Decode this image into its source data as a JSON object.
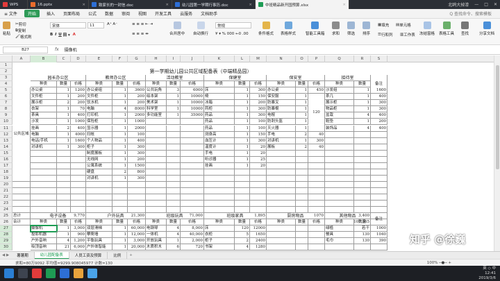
{
  "tabs": [
    {
      "label": "WPS",
      "color": "#e33b3b"
    },
    {
      "label": "16.pptx",
      "color": "#e86c2c"
    },
    {
      "label": "致家长的一封信.doc",
      "color": "#2d6fd6"
    },
    {
      "label": "幼儿园第一学期行事历.doc",
      "color": "#2d6fd6"
    },
    {
      "label": "中班精品新开园预算.xlsx",
      "color": "#1e9c54"
    }
  ],
  "window_controls": {
    "user": "北鸥大掉漆",
    "min": "—",
    "max": "□",
    "close": "✕"
  },
  "menu": {
    "file": "≡ 文件",
    "start": "开始",
    "items": [
      "插入",
      "页面布局",
      "公式",
      "数据",
      "审阅",
      "视图",
      "开发工具",
      "云服务",
      "文档助手"
    ],
    "search": "Q 查找命令、搜索模板"
  },
  "ribbon": {
    "paste": "粘贴",
    "cut": "剪切",
    "copy": "复制",
    "format_painter": "格式刷",
    "font_name": "宋体",
    "font_size": "11",
    "merge": "合并居中",
    "wrap": "自动换行",
    "number_format": "常规",
    "cond_format": "条件格式",
    "table_style": "表格样式",
    "smart_toolbox": "智能工具箱",
    "sum": "求和",
    "filter": "筛选",
    "sort": "排序",
    "fill": "填充",
    "cell": "单元格",
    "row_col": "行和列",
    "worksheet": "工作表",
    "freeze": "冻结窗格",
    "table_tools": "表格工具",
    "find": "查找",
    "symbol": "符号",
    "share": "分享文档"
  },
  "formula_bar": {
    "cell_ref": "B27",
    "fx": "fx",
    "content": "摄像机"
  },
  "columns": [
    "A",
    "B",
    "C",
    "D",
    "E",
    "F",
    "G",
    "H",
    "I",
    "J",
    "K",
    "L",
    "M",
    "N",
    "O",
    "P",
    "Q",
    "R",
    "S"
  ],
  "rows": [
    "1",
    "2",
    "3",
    "4",
    "5",
    "6",
    "7",
    "8",
    "9",
    "10",
    "11",
    "12",
    "13",
    "14",
    "15",
    "16",
    "17",
    "18",
    "19",
    "20",
    "21",
    "22",
    "23",
    "24",
    "25",
    "26",
    "27",
    "28",
    "29",
    "30"
  ],
  "sheet": {
    "title": "第一学期幼儿园公共区域配备表（中端精品园）",
    "sections_top": [
      "园长办公区",
      "教师办公区",
      "活动教室",
      "保健室",
      "保安室",
      "接待室"
    ],
    "notes": "备注",
    "hdr": [
      "种类",
      "数量",
      "价格"
    ],
    "area_label": "公共区域",
    "r5": [
      "办公桌",
      "1",
      "1200",
      "办公桌组",
      "1",
      "3600",
      "公共玩角",
      "3",
      "6000",
      "床",
      "1",
      "300",
      "办公桌",
      "1",
      "450",
      "沙发组",
      "1",
      "1600"
    ],
    "r6": [
      "文件柜",
      "1",
      "200",
      "文件柜",
      "1",
      "200",
      "绘本架",
      "1",
      "10000",
      "椅",
      "1",
      "150",
      "保安服",
      "1",
      "120",
      "茶几",
      "1",
      "400"
    ],
    "r7": [
      "展示柜",
      "2",
      "200",
      "饮水机",
      "1",
      "200",
      "美术架",
      "1",
      "10000",
      "冰箱",
      "1",
      "200",
      "防暴叉",
      "1",
      "",
      "展示柜",
      "1",
      "300"
    ],
    "r8": [
      "衣架",
      "1",
      "70",
      "电脑",
      "4",
      "8000",
      "科学室",
      "1",
      "10000",
      "药柜",
      "1",
      "300",
      "防暴棍",
      "1",
      "",
      "物品柜",
      "1",
      "300"
    ],
    "r9": [
      "茶具",
      "1",
      "400",
      "打印机",
      "1",
      "2000",
      "多功能室",
      "1",
      "35000",
      "药品",
      "1",
      "300",
      "电棍",
      "1",
      "",
      "盆栽",
      "4",
      "400"
    ],
    "r10": [
      "沙发",
      "1",
      "1000",
      "保险柜",
      "1",
      "1000",
      "",
      "",
      "",
      "药品",
      "1",
      "100",
      "防刺头盔",
      "1",
      "",
      "鞋垫",
      "1",
      "200"
    ],
    "r11": [
      "挂画",
      "2",
      "400",
      "显示器",
      "1",
      "2000",
      "",
      "",
      "",
      "药品",
      "1",
      "100",
      "灭火器",
      "1",
      "",
      "装饰品",
      "4",
      "400"
    ],
    "r12": [
      "电脑",
      "1",
      "4000",
      "扫帐",
      "1",
      "100",
      "",
      "",
      "",
      "测身高",
      "1",
      "150",
      "手电",
      "2",
      "40",
      "",
      "",
      ""
    ],
    "r13": [
      "电话/手机",
      "1",
      "1600",
      "个人物品",
      "1",
      "400",
      "",
      "",
      "",
      "血压计",
      "1",
      "300",
      "对讲机",
      "1",
      "300",
      "",
      "",
      ""
    ],
    "r14": [
      "对讲机",
      "1",
      "300",
      "柜子",
      "1",
      "300",
      "",
      "",
      "",
      "温度计",
      "1",
      "20",
      "展板",
      "2",
      "40",
      "",
      "",
      ""
    ],
    "r15": [
      "",
      "",
      "",
      "制度展板",
      "1",
      "300",
      "",
      "",
      "",
      "手电",
      "1",
      "20",
      "",
      "",
      "",
      "",
      "",
      ""
    ],
    "r16": [
      "",
      "",
      "",
      "无线网",
      "1",
      "200",
      "",
      "",
      "",
      "听诊器",
      "1",
      "25",
      "",
      "",
      "",
      "",
      "",
      ""
    ],
    "r17": [
      "",
      "",
      "",
      "公寓系统",
      "1",
      "1500",
      "",
      "",
      "",
      "挂画",
      "1",
      "20",
      "",
      "",
      "",
      "",
      "",
      ""
    ],
    "r18": [
      "",
      "",
      "",
      "硬盘",
      "2",
      "800",
      "",
      "",
      "",
      "",
      "",
      "",
      "",
      "",
      "",
      "",
      "",
      ""
    ],
    "r19": [
      "",
      "",
      "",
      "对讲机",
      "1",
      "300",
      "",
      "",
      "",
      "",
      "",
      "",
      "",
      "",
      "",
      "",
      "",
      ""
    ],
    "guard_price_merged": "120",
    "totals_label": "总计",
    "totals": [
      "9,770",
      "21,300",
      "71,000",
      "1,895",
      "1070",
      "3,400"
    ],
    "sum_label": "合计",
    "grand_total": "107,365",
    "sections_bottom": [
      "电子设备",
      "户外玩具",
      "班级玩具",
      "班级家具",
      "厨房物品",
      "其他物品"
    ],
    "r27": [
      "摄像机",
      "1",
      "3,000",
      "双层滑梯",
      "1",
      "60,000",
      "电钢琴",
      "4",
      "8,000",
      "床",
      "120",
      "12000",
      "",
      "",
      "",
      "绿植",
      "若干",
      "1000"
    ],
    "r28": [
      "投影机器",
      "1",
      "900",
      "攀爬墙",
      "1",
      "12,000",
      "一体机",
      "4",
      "40,000",
      "衣柜",
      "5",
      "1650",
      "",
      "",
      "",
      "餐具",
      "130",
      "1040"
    ],
    "r29": [
      "户外音响",
      "4",
      "1,200",
      "平衡玩具",
      "1",
      "3,000",
      "开放玩具",
      "1",
      "2,000",
      "柜子",
      "2",
      "2400",
      "",
      "",
      "",
      "毛巾",
      "130",
      "390"
    ],
    "r30": [
      "吸顶音响",
      "21",
      "6,000",
      "户外体智能",
      "1",
      "20,000",
      "木质积木",
      "6",
      "720",
      "书架",
      "4",
      "1280",
      "",
      "",
      "",
      "",
      "",
      ""
    ]
  },
  "sheet_tabs": [
    "幼儿园配备表",
    "人员工资及预算",
    "比例"
  ],
  "sheet_tabs_prefix": "薯薯期",
  "status": {
    "text": "求和=80万9092  平均值=9299.908045977  计数=130",
    "zoom": "100% ─●─ +"
  },
  "tray": {
    "time": "12:41",
    "date": "2019/3/6",
    "ime": "英 ◇ 中"
  },
  "watermark": "知乎 @徐巍"
}
